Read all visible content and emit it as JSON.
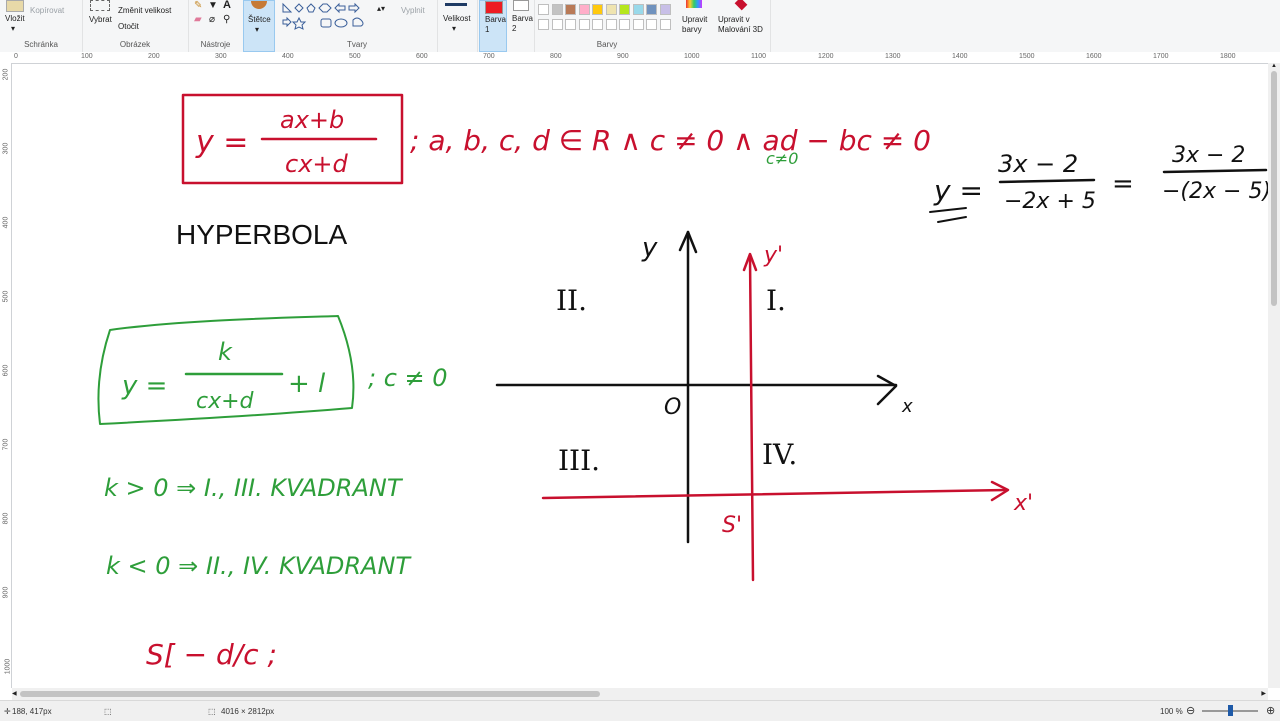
{
  "ribbon": {
    "clipboard": {
      "paste": "Vložit",
      "copy": "Kopírovat",
      "group": "Schránka"
    },
    "image": {
      "select": "Vybrat",
      "resize": "Změnit velikost",
      "rotate": "Otočit",
      "group": "Obrázek"
    },
    "tools": {
      "group": "Nástroje"
    },
    "brushes": {
      "label": "Štětce"
    },
    "shapes": {
      "fill": "Vyplnit",
      "group": "Tvary"
    },
    "size": {
      "label": "Velikost"
    },
    "color1": {
      "label": "Barva\n1"
    },
    "color2": {
      "label": "Barva\n2"
    },
    "colors": {
      "group": "Barvy",
      "edit": "Upravit barvy",
      "paint3d": "Upravit v Malování 3D"
    },
    "palette_row1": [
      "#ffffff",
      "#c3c3c3",
      "#b97a57",
      "#ffaec9",
      "#ffc90e",
      "#efe4b0",
      "#b5e61d",
      "#99d9ea",
      "#7092be",
      "#c8bfe7"
    ],
    "palette_row2": [
      "#ffffff",
      "#ffffff",
      "#ffffff",
      "#ffffff",
      "#ffffff",
      "#ffffff",
      "#ffffff",
      "#ffffff",
      "#ffffff",
      "#ffffff"
    ],
    "color1_value": "#ed1c24"
  },
  "ruler": {
    "h_ticks": [
      "0",
      "100",
      "200",
      "300",
      "400",
      "500",
      "600",
      "700",
      "800",
      "900",
      "1000",
      "1100",
      "1200",
      "1300",
      "1400",
      "1500",
      "1600",
      "1700",
      "1800"
    ],
    "v_ticks": [
      "200",
      "300",
      "400",
      "500",
      "600",
      "700",
      "800",
      "900",
      "1000"
    ]
  },
  "notes": {
    "formula_y": "y =",
    "formula_num": "ax+b",
    "formula_den": "cx+d",
    "condition": "; a, b, c, d ∈ R ∧ c ≠ 0 ∧ ad − bc ≠ 0",
    "condition_sub": "c≠0",
    "hyperbola": "HYPERBOLA",
    "green_y": "y =",
    "green_num": "k",
    "green_den": "cx+d",
    "green_plus": "+ l",
    "green_cond": "; c ≠ 0",
    "kpos": "k > 0  ⇒  I., III. KVADRANT",
    "kneg": "k < 0  ⇒  II., IV. KVADRANT",
    "center": "S[ − d/c ;",
    "right_y": "y =",
    "right_num1": "3x − 2",
    "right_den1": "−2x + 5",
    "right_eq": "=",
    "right_num2": "3x − 2",
    "right_den2": "−(2x − 5)",
    "q1": "I.",
    "q2": "II.",
    "q3": "III.",
    "q4": "IV.",
    "origin": "O",
    "axis_y": "y",
    "axis_x": "x",
    "axis_y2": "y'",
    "axis_x2": "x'",
    "s_label": "S'"
  },
  "status": {
    "cursor": "188, 417px",
    "size": "4016 × 2812px",
    "zoom": "100 %"
  }
}
